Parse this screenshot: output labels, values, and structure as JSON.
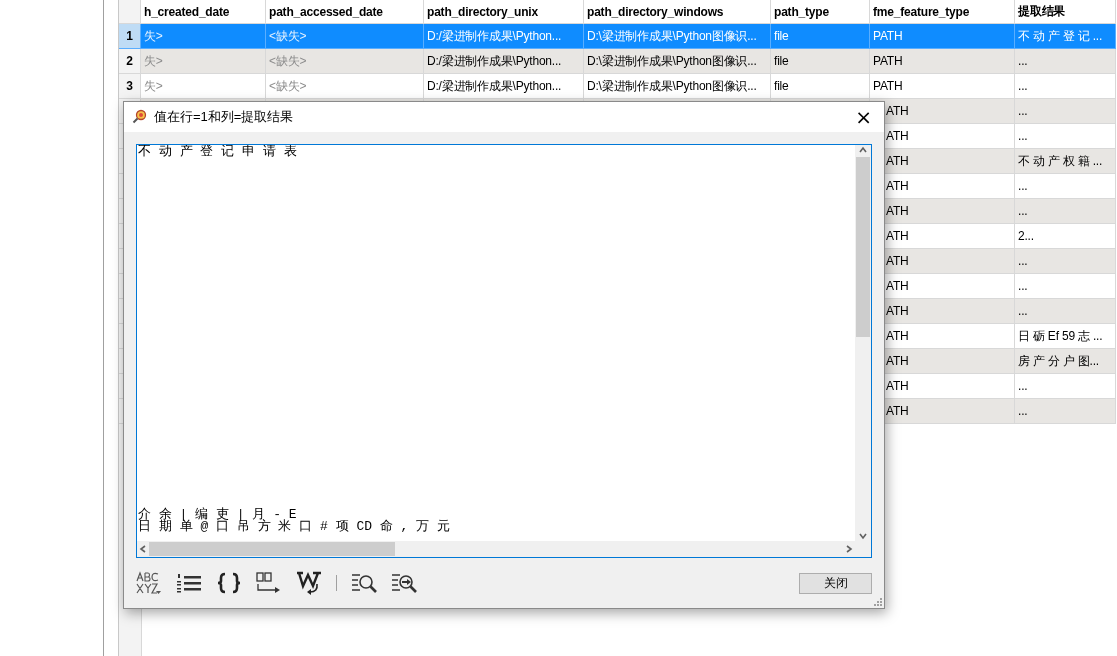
{
  "table": {
    "columns": [
      "h_created_date",
      "path_accessed_date",
      "path_directory_unix",
      "path_directory_windows",
      "path_type",
      "fme_feature_type",
      "提取结果"
    ],
    "rows": [
      {
        "number": "1",
        "selected": true,
        "cells": [
          "失>",
          "<缺失>",
          "D:/梁进制作成果\\Python...",
          "D:\\梁进制作成果\\Python图像识...",
          "file",
          "PATH",
          "不 动 产 登 记 ..."
        ],
        "missing": [
          true,
          true,
          false,
          false,
          false,
          false,
          false
        ]
      },
      {
        "number": "2",
        "selected": false,
        "cells": [
          "失>",
          "<缺失>",
          "D:/梁进制作成果\\Python...",
          "D:\\梁进制作成果\\Python图像识...",
          "file",
          "PATH",
          "..."
        ],
        "missing": [
          true,
          true,
          false,
          false,
          false,
          false,
          false
        ]
      },
      {
        "number": "3",
        "selected": false,
        "cells": [
          "失>",
          "<缺失>",
          "D:/梁进制作成果\\Python...",
          "D:\\梁进制作成果\\Python图像识...",
          "file",
          "PATH",
          "..."
        ],
        "missing": [
          true,
          true,
          false,
          false,
          false,
          false,
          false
        ]
      }
    ],
    "rows_behind_dialog": [
      {
        "fme_feature_type": "ATH",
        "result": "..."
      },
      {
        "fme_feature_type": "ATH",
        "result": "..."
      },
      {
        "fme_feature_type": "ATH",
        "result": "不 动 产 权 籍 ..."
      },
      {
        "fme_feature_type": "ATH",
        "result": "..."
      },
      {
        "fme_feature_type": "ATH",
        "result": "..."
      },
      {
        "fme_feature_type": "ATH",
        "result": "2..."
      },
      {
        "fme_feature_type": "ATH",
        "result": "..."
      },
      {
        "fme_feature_type": "ATH",
        "result": "..."
      },
      {
        "fme_feature_type": "ATH",
        "result": "..."
      },
      {
        "fme_feature_type": "ATH",
        "result": "日 砺 Ef 59 志 ..."
      },
      {
        "fme_feature_type": "ATH",
        "result": "房 产 分 户 图..."
      },
      {
        "fme_feature_type": "ATH",
        "result": "..."
      },
      {
        "fme_feature_type": "ATH",
        "result": "..."
      }
    ]
  },
  "dialog": {
    "title": "值在行=1和列=提取结果",
    "close_icon": "×",
    "text_top": [
      "不 动 产 登 记 申 请 表"
    ],
    "text_bottom": [
      "介 余 | 编 吏 | 月 - E",
      "日 期 单 @ 口 吊 方 米 口 # 项 CD 命 , 万 元"
    ],
    "close_button": "关闭"
  }
}
